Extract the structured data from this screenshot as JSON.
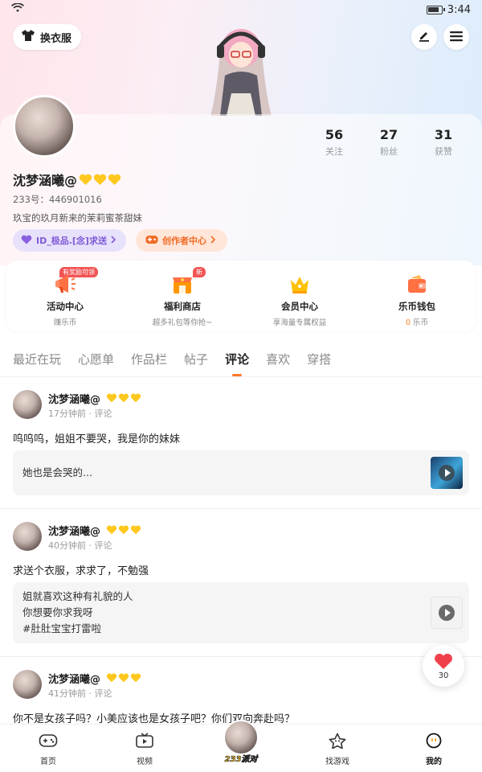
{
  "status_bar": {
    "time": "3:44"
  },
  "header": {
    "outfit_button": "换衣服",
    "edit_icon": "pencil-icon",
    "menu_icon": "menu-icon"
  },
  "profile": {
    "stats": [
      {
        "value": "56",
        "label": "关注"
      },
      {
        "value": "27",
        "label": "粉丝"
      },
      {
        "value": "31",
        "label": "获赞"
      }
    ],
    "name": "沈梦涵曦@",
    "id_line": "233号：446901016",
    "bio": "玖宝的玖月新来的茉莉蜜茶甜妹",
    "tag_gift": "ID_极品.[念]求送",
    "tag_creator": "创作者中心"
  },
  "features": [
    {
      "title": "活动中心",
      "subtitle": "赚乐币",
      "badge": "有奖励可领"
    },
    {
      "title": "福利商店",
      "subtitle": "超多礼包等你抢~",
      "badge": "新"
    },
    {
      "title": "会员中心",
      "subtitle": "享海量专属权益",
      "badge": ""
    },
    {
      "title": "乐币钱包",
      "subtitle_count": "0",
      "subtitle": "乐币",
      "badge": ""
    }
  ],
  "tabs": [
    "最近在玩",
    "心愿单",
    "作品栏",
    "帖子",
    "评论",
    "喜欢",
    "穿搭"
  ],
  "active_tab": "评论",
  "posts": [
    {
      "name": "沈梦涵曦@",
      "meta": "17分钟前 · 评论",
      "text": "呜呜呜，姐姐不要哭，我是你的妹妹",
      "quote": [
        "她也是会哭的..."
      ]
    },
    {
      "name": "沈梦涵曦@",
      "meta": "40分钟前 · 评论",
      "text": "求送个衣服，求求了，不勉强",
      "quote": [
        "姐就喜欢这种有礼貌的人",
        "你想要你求我呀",
        "#肚肚宝宝打雷啦"
      ]
    },
    {
      "name": "沈梦涵曦@",
      "meta": "41分钟前 · 评论",
      "text": "你不是女孩子吗？小美应该也是女孩子吧？你们双向奔赴吗？"
    }
  ],
  "like_fab": {
    "count": "30"
  },
  "bottom_nav": [
    {
      "label": "首页"
    },
    {
      "label": "视频"
    },
    {
      "label": "233派对"
    },
    {
      "label": "找游戏"
    },
    {
      "label": "我的"
    }
  ],
  "colors": {
    "accent": "#ff7a2b",
    "purple_tag": "#7f5ad6",
    "badge_red": "#f25454"
  }
}
